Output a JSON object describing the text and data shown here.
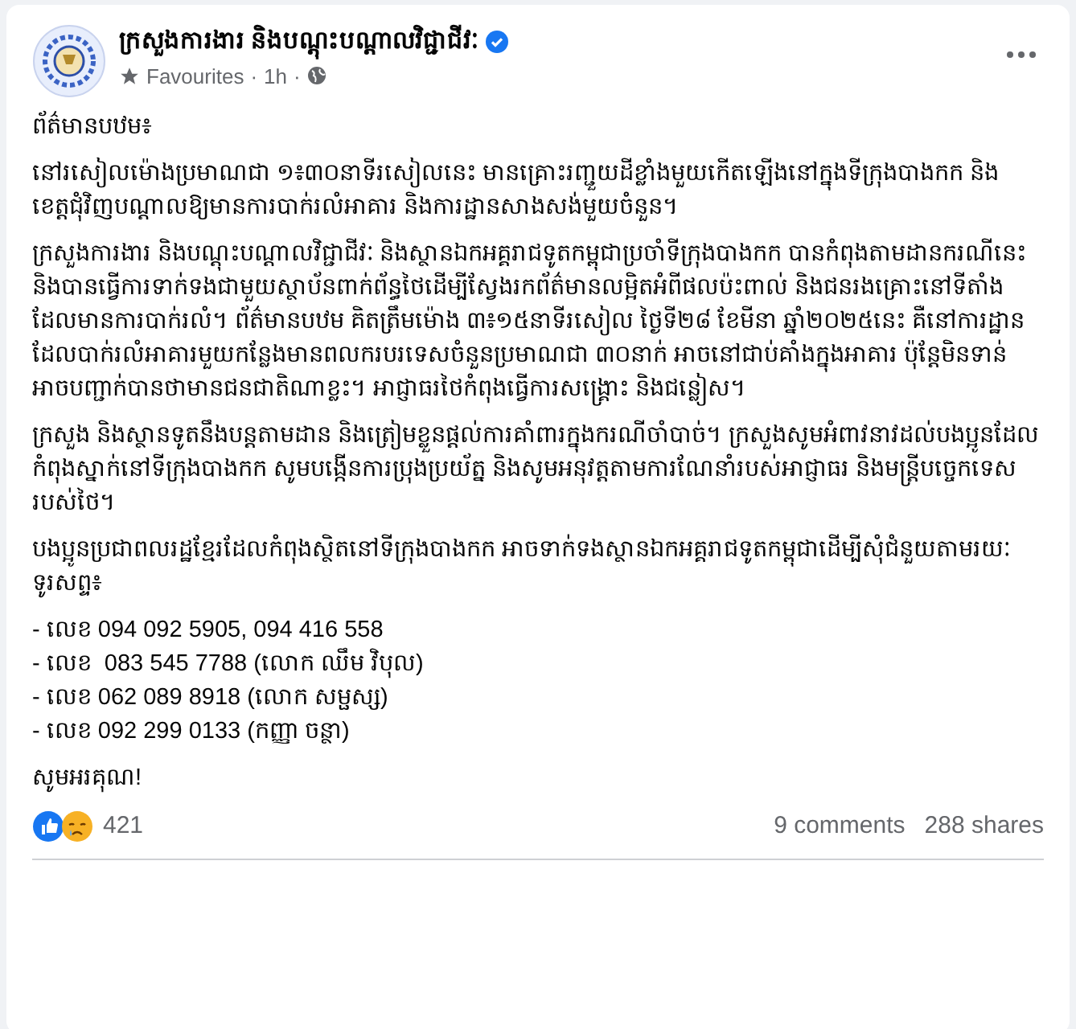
{
  "post": {
    "author": "ក្រសួងការងារ និងបណ្តុះបណ្តាលវិជ្ជាជីវៈ",
    "verified": true,
    "audience_label": "Favourites",
    "time": "1h",
    "separator": "·",
    "heading": "ព័ត៌មានបឋម៖",
    "paragraphs": [
      "នៅរសៀលម៉ោងប្រមាណជា ១៖៣០នាទីរសៀលនេះ មានគ្រោះរញ្ជួយដីខ្លាំងមួយកើតឡើងនៅក្នុងទីក្រុងបាងកក និងខេត្តជុំវិញបណ្តាលឱ្យមានការបាក់រលំអាគារ និងការដ្ឋានសាងសង់មួយចំនួន។",
      "ក្រសួងការងារ និងបណ្តុះបណ្តាលវិជ្ជាជីវៈ និងស្ថានឯកអគ្គរាជទូតកម្ពុជាប្រចាំទីក្រុងបាងកក បានកំពុងតាមដានករណីនេះ និងបានធ្វើការទាក់ទងជាមួយស្ថាប័នពាក់ព័ន្ធថៃដើម្បីស្វែងរកព័ត៌មានលម្អិតអំពីផលប៉ះពាល់ និងជនរងគ្រោះនៅទីតាំងដែលមានការបាក់រលំ។ ព័ត៌មានបឋម គិតត្រឹមម៉ោង ៣៖១៥នាទីរសៀល ថ្ងៃទី២៨ ខែមីនា ឆ្នាំ២០២៥នេះ គឺនៅការដ្ឋានដែលបាក់រលំអាគារមួយកន្លែងមានពលករបរទេសចំនួនប្រមាណជា ៣០នាក់ អាចនៅជាប់គាំងក្នុងអាគារ ប៉ុន្តែមិនទាន់អាចបញ្ជាក់បានថាមានជនជាតិណាខ្លះ។ អាជ្ញាធរថៃកំពុងធ្វើការសង្គ្រោះ និងជន្លៀស។",
      "ក្រសួង និងស្ថានទូតនឹងបន្តតាមដាន និងត្រៀមខ្លួនផ្តល់ការគាំពារក្នុងករណីចាំបាច់។ ក្រសួងសូមអំពាវនាវដល់បងប្អូនដែលកំពុងស្នាក់នៅទីក្រុងបាងកក សូមបង្កើនការប្រុងប្រយ័ត្ន និងសូមអនុវត្តតាមការណែនាំរបស់អាជ្ញាធរ និងមន្ត្រីបច្ចេកទេសរបស់ថៃ។",
      "បងប្អូនប្រជាពលរដ្ឋខ្មែរដែលកំពុងស្ថិតនៅទីក្រុងបាងកក អាចទាក់ទងស្ថានឯកអគ្គរាជទូតកម្ពុជាដើម្បីសុំជំនួយតាមរយៈ ទូរសព្ទ៖"
    ],
    "contacts": [
      "- លេខ 094 092 5905, 094 416 558",
      "- លេខ  083 545 7788 (លោក ឈឹម វិបុល)",
      "- លេខ 062 089 8918 (លោក សម្ផស្ស)",
      "- លេខ 092 299 0133 (កញ្ញា ចន្ថា)"
    ],
    "closing": "សូមអរគុណ!",
    "reaction_count": "421",
    "comments": "9 comments",
    "shares": "288 shares"
  }
}
